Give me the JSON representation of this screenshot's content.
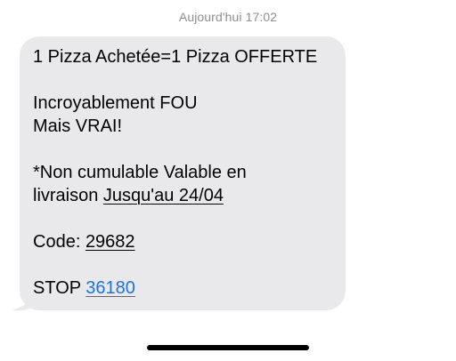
{
  "thread": {
    "timestamp": "Aujourd'hui 17:02"
  },
  "message": {
    "line1": "1 Pizza Achetée=1 Pizza OFFERTE",
    "line2": "Incroyablement FOU",
    "line3": "Mais VRAI!",
    "line4": "*Non cumulable Valable en",
    "line5_prefix": "livraison ",
    "line5_date": "Jusqu'au 24/04",
    "code_label": "Code: ",
    "code_value": "29682",
    "stop_label": "STOP ",
    "stop_number": "36180"
  },
  "colors": {
    "bubble_background": "#e9e9eb",
    "timestamp_text": "#8e8e93",
    "link": "#1a73e8",
    "home_indicator": "#000000"
  }
}
